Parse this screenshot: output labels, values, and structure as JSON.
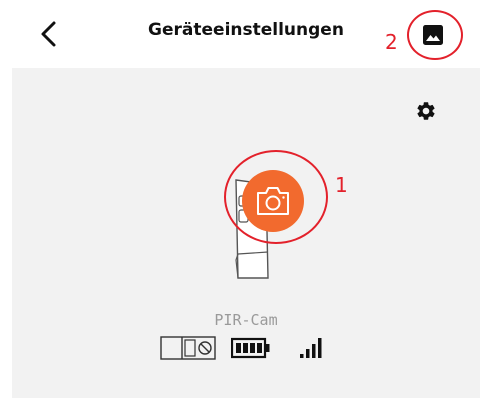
{
  "header": {
    "title": "Geräteeinstellungen",
    "back_icon": "chevron-left-icon",
    "gallery_icon": "image-gallery-icon"
  },
  "annotations": [
    {
      "number": "1",
      "target": "snapshot-button"
    },
    {
      "number": "2",
      "target": "gallery-button"
    }
  ],
  "device": {
    "name": "PIR-Cam",
    "settings_icon": "gear-icon",
    "snapshot_icon": "camera-icon",
    "status_icons": [
      "door-sensor-icon",
      "battery-icon",
      "signal-icon"
    ],
    "battery_level": 1.0,
    "signal_bars": 4
  },
  "colors": {
    "accent": "#f26a2e",
    "annotation": "#e3212b",
    "panel_bg": "#f2f2f2",
    "title_text": "#111111",
    "device_name_text": "#9a9a9a"
  }
}
